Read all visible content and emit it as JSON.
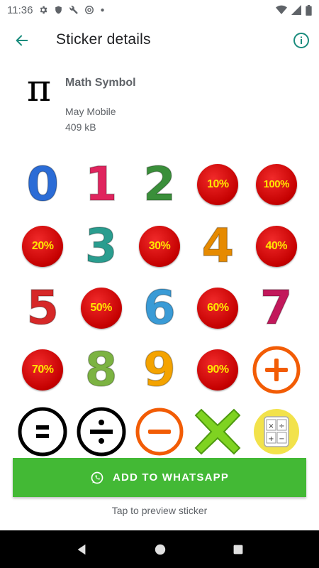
{
  "status_bar": {
    "time": "11:36"
  },
  "app_bar": {
    "title": "Sticker details"
  },
  "pack": {
    "icon_glyph": "π",
    "name": "Math Symbol",
    "publisher": "May Mobile",
    "size": "409 kB"
  },
  "stickers": {
    "digit_0": "0",
    "digit_1": "1",
    "digit_2": "2",
    "digit_3": "3",
    "digit_4": "4",
    "digit_5": "5",
    "digit_6": "6",
    "digit_7": "7",
    "digit_8": "8",
    "digit_9": "9",
    "pct_10": "10%",
    "pct_20": "20%",
    "pct_30": "30%",
    "pct_40": "40%",
    "pct_50": "50%",
    "pct_60": "60%",
    "pct_70": "70%",
    "pct_90": "90%",
    "pct_100": "100%",
    "colors": {
      "digit_0": "#2b6cd6",
      "digit_1": "#e0245e",
      "digit_2": "#3a8f3a",
      "digit_3": "#2a9d8f",
      "digit_4": "#e68a00",
      "digit_5": "#d62828",
      "digit_6": "#3a9bd6",
      "digit_7": "#c2185b",
      "digit_8": "#7cb342",
      "digit_9": "#f4a300",
      "plus": "#f25c05",
      "minus": "#f25c05",
      "check_cross": "#7fd321",
      "calc_bg": "#f2e24b"
    }
  },
  "cta": {
    "label": "ADD TO WHATSAPP",
    "color": "#43b935"
  },
  "hint": "Tap to preview sticker"
}
